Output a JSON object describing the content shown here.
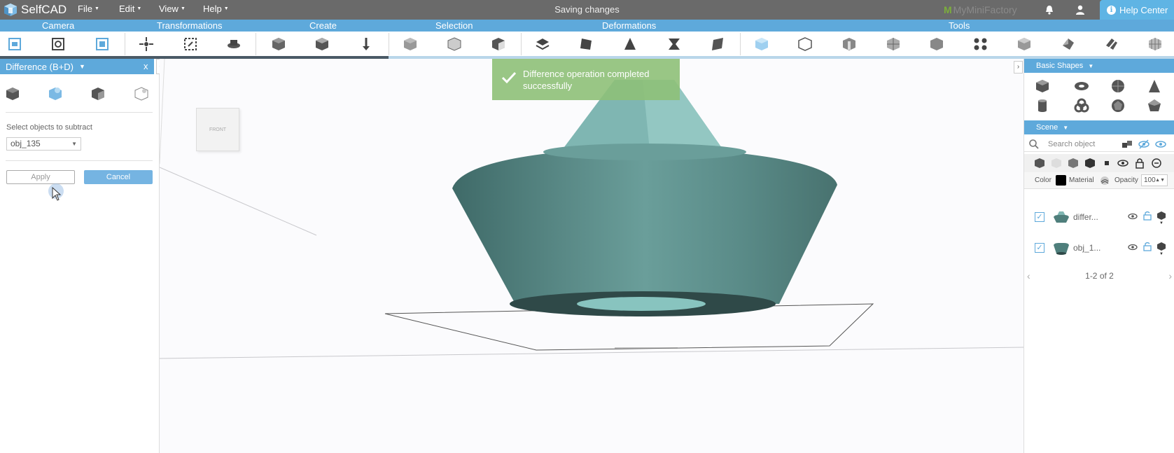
{
  "app": {
    "name": "SelfCAD",
    "status": "Saving changes",
    "partner": "MyMiniFactory",
    "help_label": "Help Center"
  },
  "menu": [
    "File",
    "Edit",
    "View",
    "Help"
  ],
  "tool_groups": [
    "Camera",
    "Transformations",
    "Create",
    "Selection",
    "Deformations",
    "Tools"
  ],
  "left_panel": {
    "title": "Difference (B+D)",
    "close": "x",
    "collapse": "‹",
    "select_label": "Select objects to subtract",
    "select_value": "obj_135",
    "apply_label": "Apply",
    "cancel_label": "Cancel"
  },
  "viewport": {
    "view_cube_label": "FRONT",
    "toast": "Difference operation completed successfully",
    "expand": "›"
  },
  "right_panel": {
    "basic_shapes_title": "Basic Shapes",
    "scene_title": "Scene",
    "search_placeholder": "Search object",
    "color_label": "Color",
    "material_label": "Material",
    "opacity_label": "Opacity",
    "opacity_value": "100",
    "objects": [
      {
        "name": "differ...",
        "checked": true
      },
      {
        "name": "obj_1...",
        "checked": true
      }
    ],
    "pagination": "1-2 of 2",
    "prev": "‹",
    "next": "›"
  },
  "colors": {
    "accent": "#5ea9db",
    "toast": "#8ec078",
    "model": "#5e9290",
    "topbar": "#6a6a6a"
  },
  "icons": [
    "selfcad-logo-icon",
    "bell-icon",
    "user-icon",
    "info-icon",
    "checkmark-icon",
    "search-icon",
    "eye-icon",
    "lock-icon",
    "cube-icon"
  ]
}
